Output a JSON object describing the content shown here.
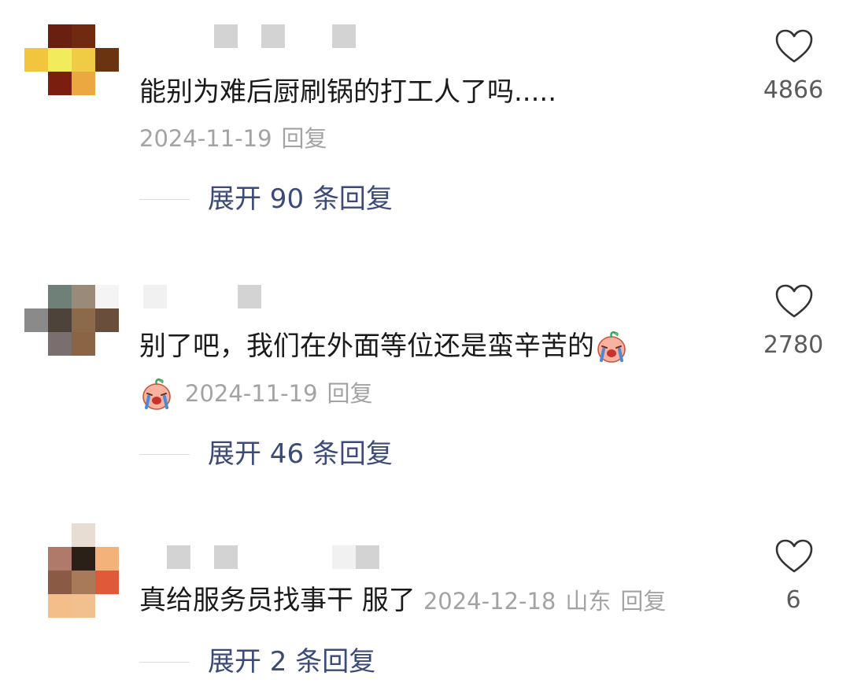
{
  "comments": [
    {
      "text": "能别为难后厨刷锅的打工人了吗.....",
      "date": "2024-11-19",
      "reply_label": "回复",
      "expand_label": "展开 90 条回复",
      "likes": "4866"
    },
    {
      "text": "别了吧，我们在外面等位还是蛮辛苦的",
      "emoji": "crying-face",
      "date": "2024-11-19",
      "reply_label": "回复",
      "expand_label": "展开 46 条回复",
      "likes": "2780"
    },
    {
      "text": "真给服务员找事干 服了",
      "date": "2024-12-18",
      "location": "山东",
      "reply_label": "回复",
      "expand_label": "展开 2 条回复",
      "likes": "6"
    }
  ],
  "icons": {
    "like": "heart-icon"
  },
  "colors": {
    "expand_link": "#3b4a78",
    "meta": "#a3a3a3",
    "text": "#1a1a1a"
  }
}
